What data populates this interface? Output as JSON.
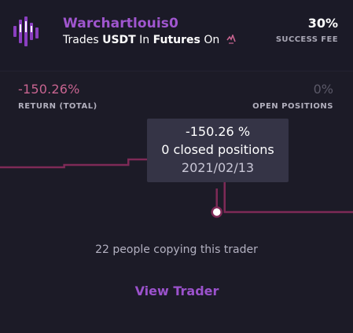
{
  "trader": {
    "name": "Warchartlouis0",
    "trades_word": "Trades",
    "asset": "USDT",
    "in_word": "In",
    "market": "Futures",
    "on_word": "On",
    "logo_icon": "candlestick-logo-icon",
    "exchange_icon": "exchange-link-icon"
  },
  "success_fee": {
    "value": "30%",
    "label": "SUCCESS FEE"
  },
  "stats": {
    "return_value": "-150.26%",
    "return_label": "RETURN (TOTAL)",
    "open_value": "0%",
    "open_label": "OPEN POSITIONS"
  },
  "chart_data": {
    "type": "line",
    "series": [
      {
        "values": [
          0,
          0,
          0,
          0,
          0,
          0,
          0,
          -150.26,
          -150.26,
          -150.26,
          -150.26,
          -150.26
        ]
      }
    ],
    "highlight_index": 7,
    "tooltip": {
      "return": "-150.26 %",
      "positions": "0 closed positions",
      "date": "2021/02/13"
    },
    "line_color": "#7e2a57",
    "point_color": "#ffffff"
  },
  "footer": {
    "copying_text": "22 people copying this trader",
    "view_button": "View Trader"
  },
  "colors": {
    "background": "#1c1b27",
    "accent": "#a056cf",
    "negative": "#c86490",
    "muted": "#5b5968"
  }
}
